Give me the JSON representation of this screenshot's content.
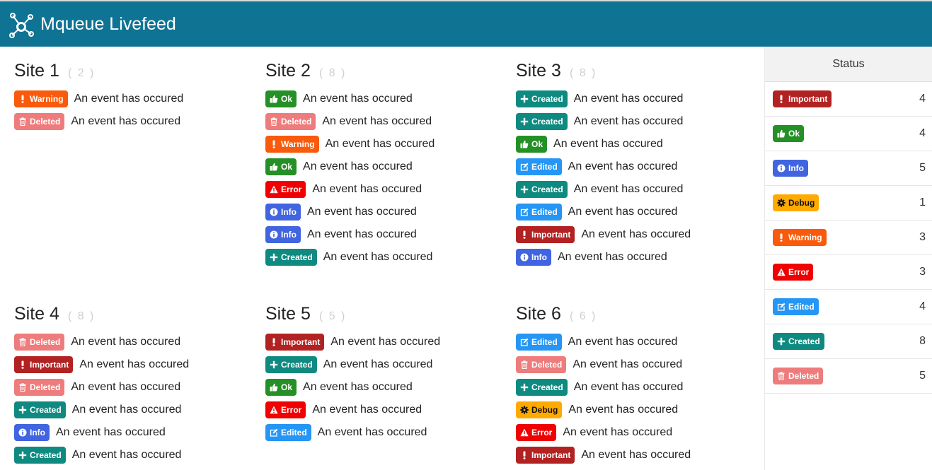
{
  "header": {
    "title": "Mqueue Livefeed"
  },
  "badge_types": {
    "warning": {
      "label": "Warning",
      "color": "#f95a0b",
      "text_color": "#ffffff",
      "icon": "exclamation-icon"
    },
    "deleted": {
      "label": "Deleted",
      "color": "#ee7c7c",
      "text_color": "#ffffff",
      "icon": "trash-icon"
    },
    "ok": {
      "label": "Ok",
      "color": "#249025",
      "text_color": "#ffffff",
      "icon": "thumbs-up-icon"
    },
    "error": {
      "label": "Error",
      "color": "#f00000",
      "text_color": "#ffffff",
      "icon": "alert-triangle-icon"
    },
    "info": {
      "label": "Info",
      "color": "#4164e0",
      "text_color": "#ffffff",
      "icon": "info-circle-icon"
    },
    "created": {
      "label": "Created",
      "color": "#0f8a80",
      "text_color": "#ffffff",
      "icon": "plus-icon"
    },
    "edited": {
      "label": "Edited",
      "color": "#2596f5",
      "text_color": "#ffffff",
      "icon": "edit-icon"
    },
    "important": {
      "label": "Important",
      "color": "#b22222",
      "text_color": "#ffffff",
      "icon": "exclamation-icon"
    },
    "debug": {
      "label": "Debug",
      "color": "#ffaa00",
      "text_color": "#111111",
      "icon": "gear-icon"
    }
  },
  "sites": [
    {
      "name": "Site 1",
      "count": "( 2 )",
      "events": [
        {
          "type": "warning",
          "text": "An event has occured"
        },
        {
          "type": "deleted",
          "text": "An event has occured"
        }
      ]
    },
    {
      "name": "Site 2",
      "count": "( 8 )",
      "events": [
        {
          "type": "ok",
          "text": "An event has occured"
        },
        {
          "type": "deleted",
          "text": "An event has occured"
        },
        {
          "type": "warning",
          "text": "An event has occured"
        },
        {
          "type": "ok",
          "text": "An event has occured"
        },
        {
          "type": "error",
          "text": "An event has occured"
        },
        {
          "type": "info",
          "text": "An event has occured"
        },
        {
          "type": "info",
          "text": "An event has occured"
        },
        {
          "type": "created",
          "text": "An event has occured"
        }
      ]
    },
    {
      "name": "Site 3",
      "count": "( 8 )",
      "events": [
        {
          "type": "created",
          "text": "An event has occured"
        },
        {
          "type": "created",
          "text": "An event has occured"
        },
        {
          "type": "ok",
          "text": "An event has occured"
        },
        {
          "type": "edited",
          "text": "An event has occured"
        },
        {
          "type": "created",
          "text": "An event has occured"
        },
        {
          "type": "edited",
          "text": "An event has occured"
        },
        {
          "type": "important",
          "text": "An event has occured"
        },
        {
          "type": "info",
          "text": "An event has occured"
        }
      ]
    },
    {
      "name": "Site 4",
      "count": "( 8 )",
      "events": [
        {
          "type": "deleted",
          "text": "An event has occured"
        },
        {
          "type": "important",
          "text": "An event has occured"
        },
        {
          "type": "deleted",
          "text": "An event has occured"
        },
        {
          "type": "created",
          "text": "An event has occured"
        },
        {
          "type": "info",
          "text": "An event has occured"
        },
        {
          "type": "created",
          "text": "An event has occured"
        }
      ]
    },
    {
      "name": "Site 5",
      "count": "( 5 )",
      "events": [
        {
          "type": "important",
          "text": "An event has occured"
        },
        {
          "type": "created",
          "text": "An event has occured"
        },
        {
          "type": "ok",
          "text": "An event has occured"
        },
        {
          "type": "error",
          "text": "An event has occured"
        },
        {
          "type": "edited",
          "text": "An event has occured"
        }
      ]
    },
    {
      "name": "Site 6",
      "count": "( 6 )",
      "events": [
        {
          "type": "edited",
          "text": "An event has occured"
        },
        {
          "type": "deleted",
          "text": "An event has occured"
        },
        {
          "type": "created",
          "text": "An event has occured"
        },
        {
          "type": "debug",
          "text": "An event has occured"
        },
        {
          "type": "error",
          "text": "An event has occured"
        },
        {
          "type": "important",
          "text": "An event has occured"
        }
      ]
    }
  ],
  "status": {
    "title": "Status",
    "rows": [
      {
        "type": "important",
        "count": "4"
      },
      {
        "type": "ok",
        "count": "4"
      },
      {
        "type": "info",
        "count": "5"
      },
      {
        "type": "debug",
        "count": "1"
      },
      {
        "type": "warning",
        "count": "3"
      },
      {
        "type": "error",
        "count": "3"
      },
      {
        "type": "edited",
        "count": "4"
      },
      {
        "type": "created",
        "count": "8"
      },
      {
        "type": "deleted",
        "count": "5"
      }
    ]
  }
}
